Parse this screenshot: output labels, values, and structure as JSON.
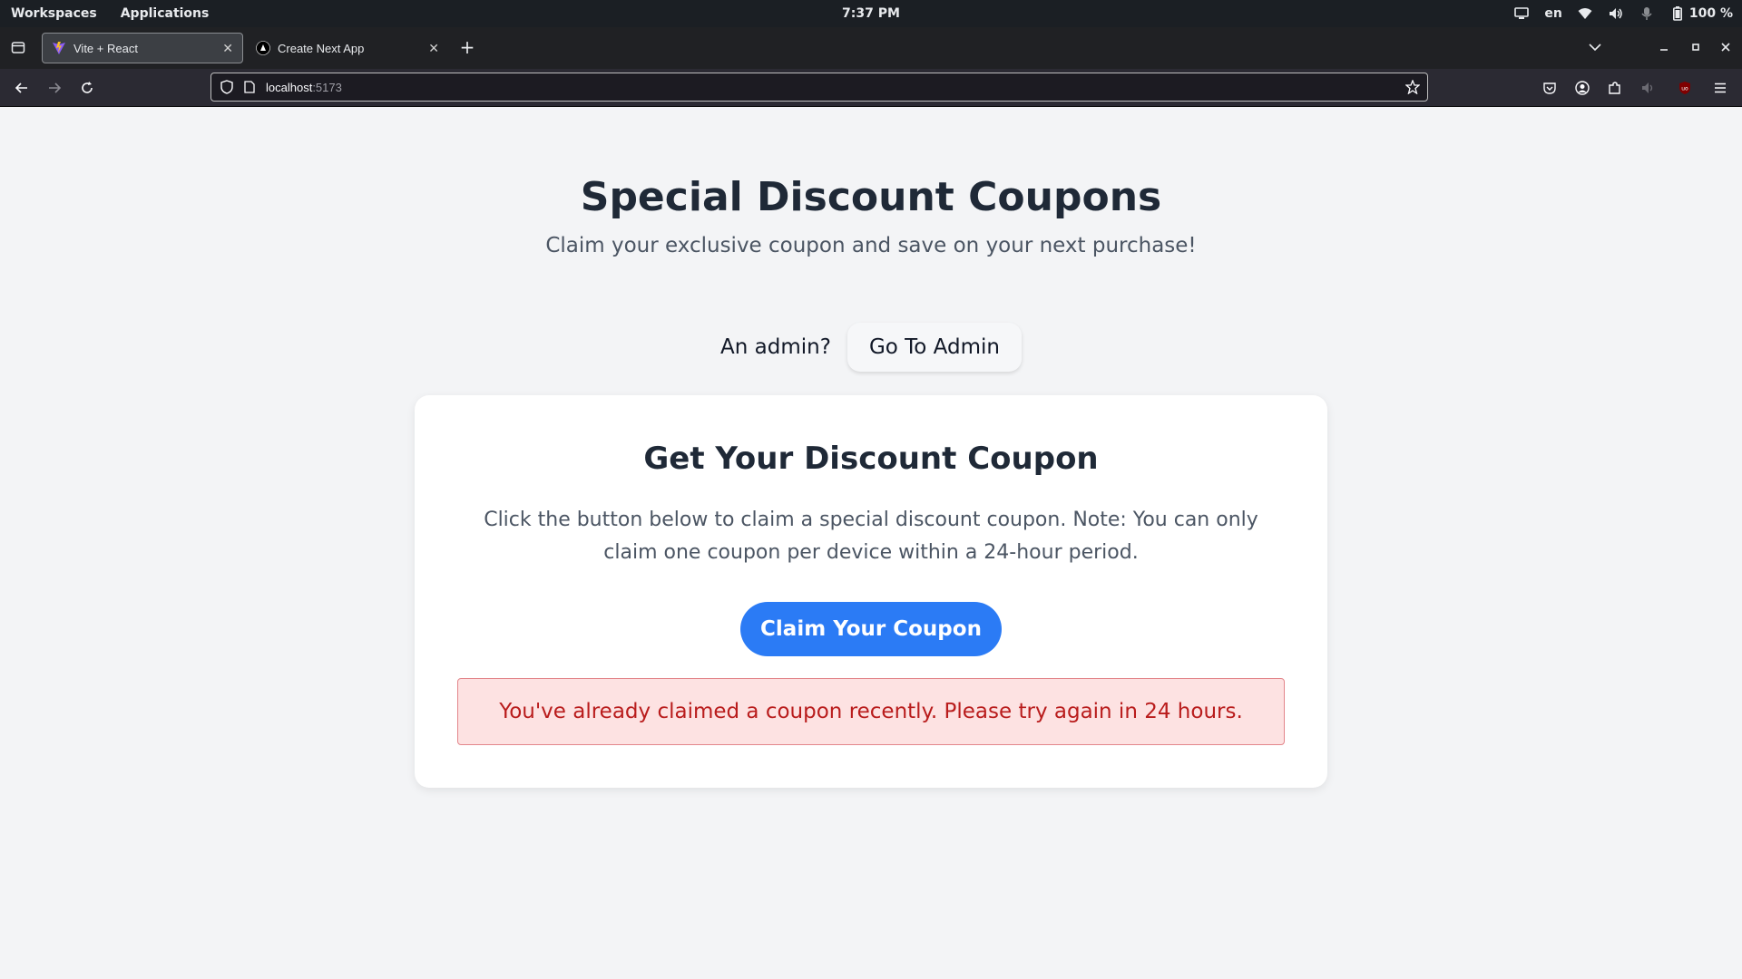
{
  "os": {
    "workspaces": "Workspaces",
    "applications": "Applications",
    "clock": "7:37 PM",
    "language": "en",
    "battery": "100 %",
    "icons": [
      "screen-share-icon",
      "wifi-icon",
      "volume-icon",
      "microphone-icon",
      "battery-icon"
    ]
  },
  "browser": {
    "tabs": [
      {
        "title": "Vite + React",
        "favicon": "vite-logo-icon",
        "active": true
      },
      {
        "title": "Create Next App",
        "favicon": "nextjs-logo-icon",
        "active": false
      }
    ],
    "url": {
      "host": "localhost",
      "port": ":5173"
    },
    "colors": {
      "chrome_dark": "#202124",
      "toolbar": "#2b2a33"
    }
  },
  "page": {
    "title": "Special Discount Coupons",
    "subtitle": "Claim your exclusive coupon and save on your next purchase!",
    "admin_prompt": "An admin?",
    "admin_button": "Go To Admin",
    "card": {
      "title": "Get Your Discount Coupon",
      "description": "Click the button below to claim a special discount coupon. Note: You can only claim one coupon per device within a 24-hour period.",
      "claim_button": "Claim Your Coupon",
      "error_message": "You've already claimed a coupon recently. Please try again in 24 hours."
    },
    "colors": {
      "primary": "#2b7bf5",
      "error_bg": "#fde2e2",
      "error_text": "#b91c1c",
      "background": "#f3f4f6"
    }
  }
}
